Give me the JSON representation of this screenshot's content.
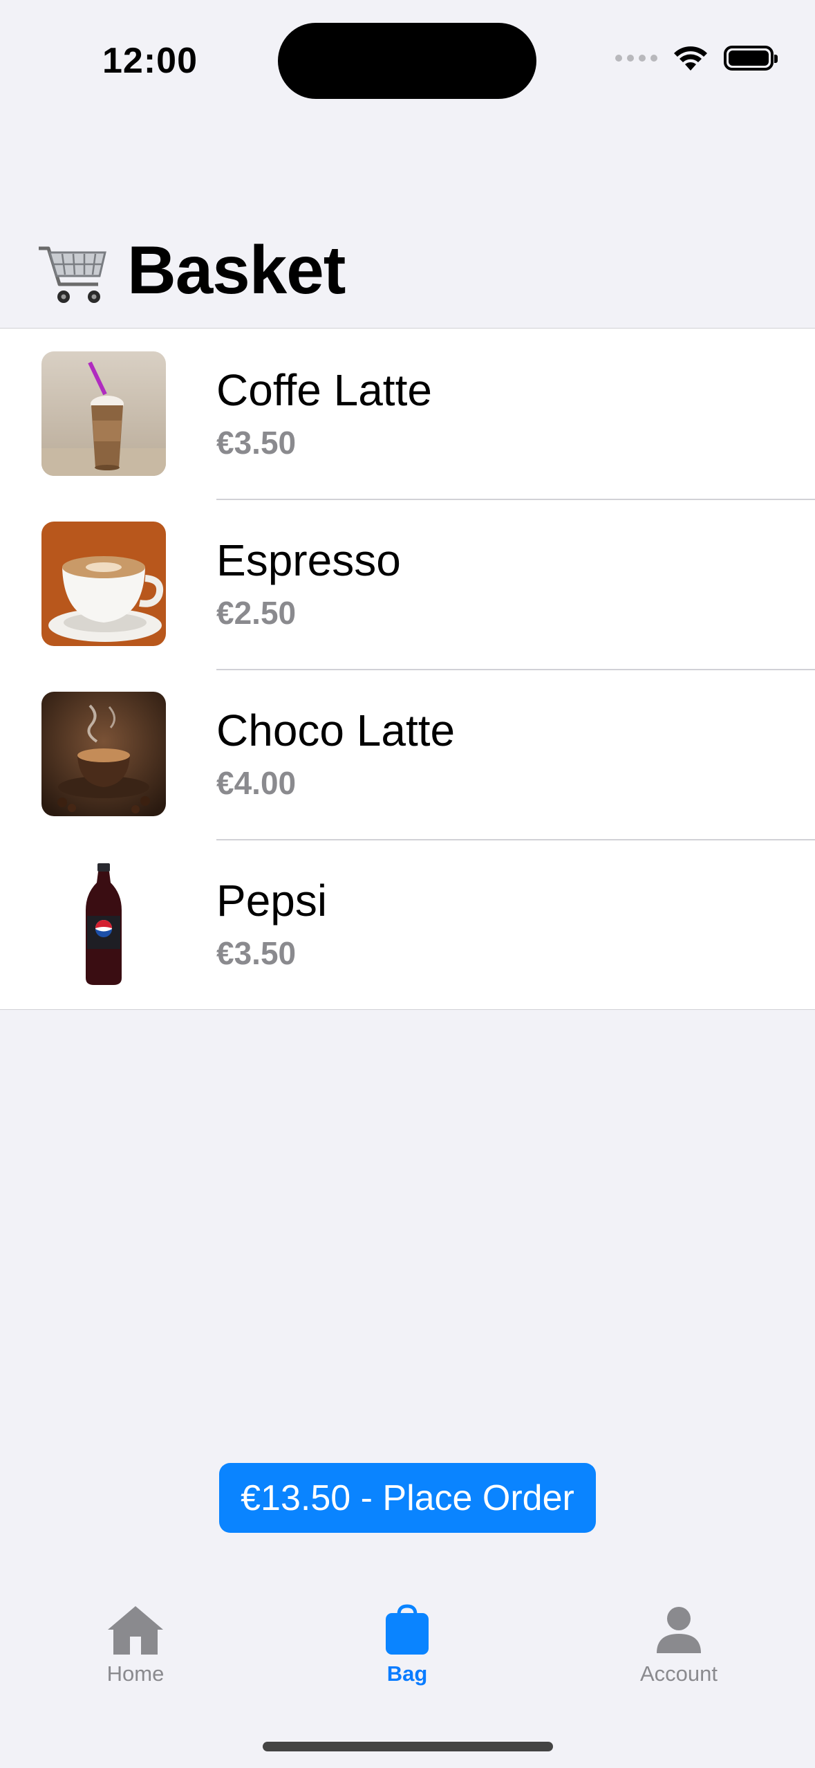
{
  "status": {
    "time": "12:00"
  },
  "page": {
    "title": "Basket",
    "title_icon": "shopping-cart-icon"
  },
  "items": [
    {
      "name": "Coffe Latte",
      "price": "€3.50"
    },
    {
      "name": "Espresso",
      "price": "€2.50"
    },
    {
      "name": "Choco Latte",
      "price": "€4.00"
    },
    {
      "name": "Pepsi",
      "price": "€3.50"
    }
  ],
  "order_button": {
    "label": "€13.50 - Place Order"
  },
  "tabs": [
    {
      "label": "Home",
      "icon": "house-icon",
      "active": false
    },
    {
      "label": "Bag",
      "icon": "bag-icon",
      "active": true
    },
    {
      "label": "Account",
      "icon": "person-icon",
      "active": false
    }
  ],
  "colors": {
    "accent": "#0a84ff",
    "background": "#f2f2f7",
    "secondary_text": "#8a8a8e"
  }
}
